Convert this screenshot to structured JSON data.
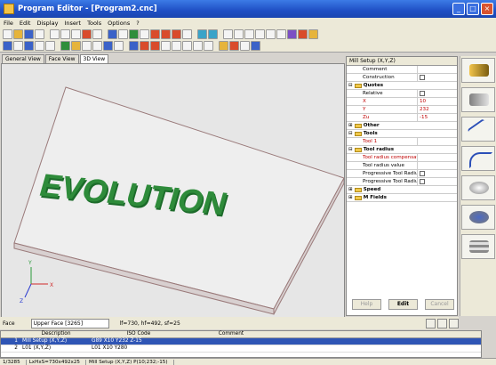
{
  "window": {
    "title": "Program Editor - [Program2.cnc]"
  },
  "menu": [
    "File",
    "Edit",
    "Display",
    "Insert",
    "Tools",
    "Options",
    "?"
  ],
  "view_tabs": [
    "General View",
    "Face View",
    "3D View"
  ],
  "viewport": {
    "engraving_text": "EVOLUTION",
    "axis_x": "X",
    "axis_y": "Y",
    "axis_z": "Z"
  },
  "props": {
    "header": "Mill Setup (X,Y,Z)",
    "rows": [
      {
        "kind": "item",
        "label": "Comment",
        "value": ""
      },
      {
        "kind": "item",
        "label": "Construction",
        "value": "",
        "check": true
      },
      {
        "kind": "group",
        "label": "Quotes"
      },
      {
        "kind": "item",
        "label": "Relative",
        "value": "",
        "check": true
      },
      {
        "kind": "item-red",
        "label": "X",
        "value": "10"
      },
      {
        "kind": "item-red",
        "label": "Y",
        "value": "232"
      },
      {
        "kind": "item-red",
        "label": "Zu",
        "value": "-15"
      },
      {
        "kind": "group-col",
        "label": "Other"
      },
      {
        "kind": "group",
        "label": "Tools"
      },
      {
        "kind": "item-red",
        "label": "Tool 1",
        "value": ""
      },
      {
        "kind": "group",
        "label": "Tool radius"
      },
      {
        "kind": "item-red",
        "label": "Tool radius compensation",
        "value": ""
      },
      {
        "kind": "item",
        "label": "Tool radius value",
        "value": ""
      },
      {
        "kind": "item",
        "label": "Progressive Tool Radius Out",
        "value": "",
        "check": true
      },
      {
        "kind": "item",
        "label": "Progressive Tool Radius In",
        "value": "",
        "check": true
      },
      {
        "kind": "group-col",
        "label": "Speed"
      },
      {
        "kind": "group-col",
        "label": "M Fields"
      }
    ],
    "buttons": {
      "help": "Help",
      "edit": "Edit",
      "cancel": "Cancel"
    }
  },
  "face": {
    "label": "Face",
    "selected": "Upper Face [3265]",
    "coords": "lf=730, hf=492, sf=25"
  },
  "grid": {
    "headers": [
      "Description",
      "ISO Code",
      "Comment"
    ],
    "rows": [
      {
        "n": "1",
        "desc": "Mill Setup (X,Y,Z)",
        "iso": "G89 X10 Y232 Z-15",
        "comment": ""
      },
      {
        "n": "2",
        "desc": "L01 (X,Y,Z)",
        "iso": "L01 X10 Y280",
        "comment": ""
      }
    ]
  },
  "status": {
    "count": "1/3285",
    "dims": "LxHxS=730x492x25",
    "info": "Mill Setup (X,Y,Z) P(10;232;-15)"
  },
  "colors": {
    "engraving": "#2e8b3a",
    "title_bar": "#2456c8",
    "selected_row": "#2f55b5"
  }
}
